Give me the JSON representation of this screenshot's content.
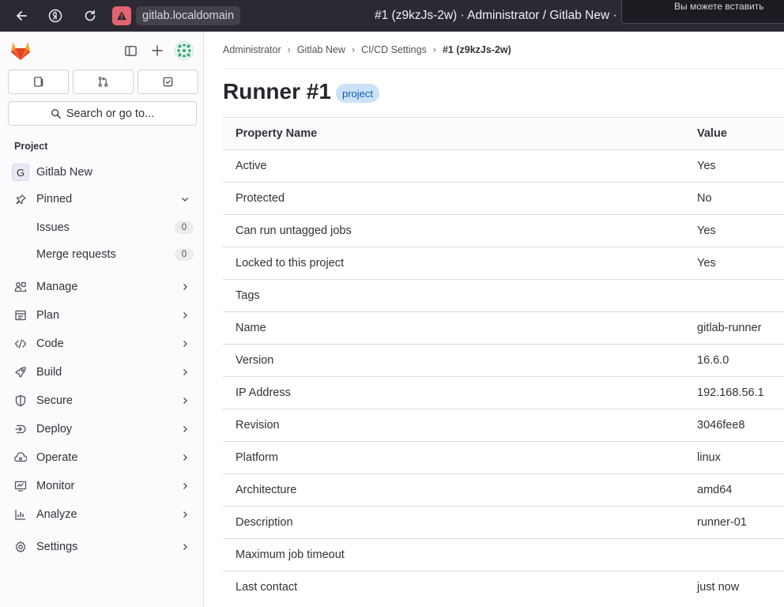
{
  "browser": {
    "url": "gitlab.localdomain",
    "title": "#1 (z9kzJs-2w) · Administrator / Gitlab New · ",
    "notification": "Вы можете вставить"
  },
  "sidebar": {
    "search_label": "Search or go to...",
    "section_label": "Project",
    "project": {
      "initial": "G",
      "name": "Gitlab New"
    },
    "pinned_label": "Pinned",
    "pinned_items": [
      {
        "label": "Issues",
        "count": "0"
      },
      {
        "label": "Merge requests",
        "count": "0"
      }
    ],
    "items": [
      {
        "label": "Manage",
        "icon": "users-icon"
      },
      {
        "label": "Plan",
        "icon": "plan-icon"
      },
      {
        "label": "Code",
        "icon": "code-icon"
      },
      {
        "label": "Build",
        "icon": "rocket-icon"
      },
      {
        "label": "Secure",
        "icon": "shield-icon"
      },
      {
        "label": "Deploy",
        "icon": "deploy-icon"
      },
      {
        "label": "Operate",
        "icon": "cloud-gear-icon"
      },
      {
        "label": "Monitor",
        "icon": "monitor-icon"
      },
      {
        "label": "Analyze",
        "icon": "chart-icon"
      },
      {
        "label": "Settings",
        "icon": "gear-icon"
      }
    ]
  },
  "breadcrumb": [
    "Administrator",
    "Gitlab New",
    "CI/CD Settings",
    "#1 (z9kzJs-2w)"
  ],
  "page": {
    "title": "Runner #1",
    "badge": "project"
  },
  "table": {
    "headers": [
      "Property Name",
      "Value"
    ],
    "rows": [
      [
        "Active",
        "Yes"
      ],
      [
        "Protected",
        "No"
      ],
      [
        "Can run untagged jobs",
        "Yes"
      ],
      [
        "Locked to this project",
        "Yes"
      ],
      [
        "Tags",
        ""
      ],
      [
        "Name",
        "gitlab-runner"
      ],
      [
        "Version",
        "16.6.0"
      ],
      [
        "IP Address",
        "192.168.56.1"
      ],
      [
        "Revision",
        "3046fee8"
      ],
      [
        "Platform",
        "linux"
      ],
      [
        "Architecture",
        "amd64"
      ],
      [
        "Description",
        "runner-01"
      ],
      [
        "Maximum job timeout",
        ""
      ],
      [
        "Last contact",
        "just now"
      ]
    ]
  },
  "colors": {
    "brand": "#fc6d26",
    "badge_bg": "#cbe2f9",
    "badge_text": "#0b5cad",
    "browser_bar": "#2b2a33"
  }
}
